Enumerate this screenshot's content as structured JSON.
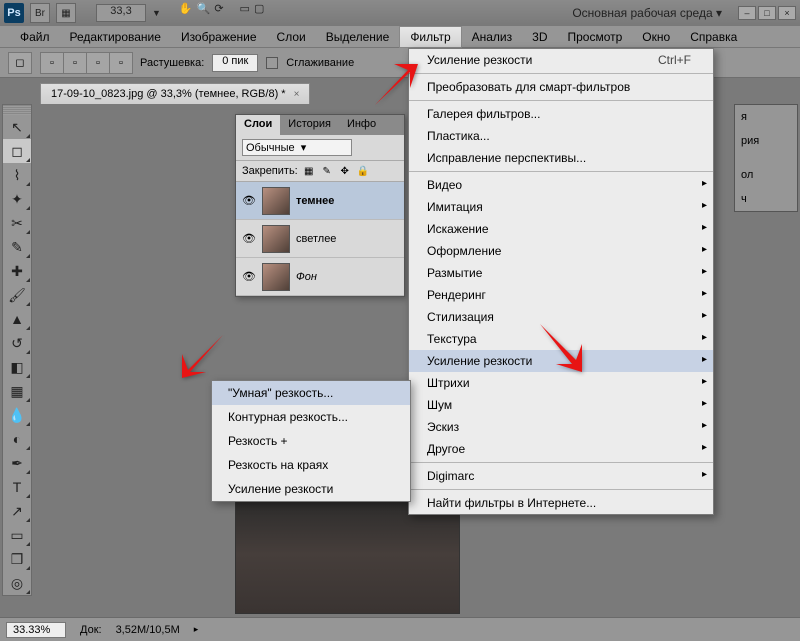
{
  "titlebar": {
    "zoom": "33,3",
    "workspace": "Основная рабочая среда ▾"
  },
  "menubar": {
    "items": [
      "Файл",
      "Редактирование",
      "Изображение",
      "Слои",
      "Выделение",
      "Фильтр",
      "Анализ",
      "3D",
      "Просмотр",
      "Окно",
      "Справка"
    ],
    "active_index": 5
  },
  "optionsbar": {
    "feather_label": "Растушевка:",
    "feather_value": "0 пик",
    "antialias_label": "Сглаживание"
  },
  "doctab": {
    "title": "17-09-10_0823.jpg @ 33,3% (темнее, RGB/8) *"
  },
  "layers_panel": {
    "tabs": [
      "Слои",
      "История",
      "Инфо"
    ],
    "active_tab": 0,
    "blend_mode": "Обычные",
    "lock_label": "Закрепить:",
    "layers": [
      {
        "name": "темнее",
        "selected": true,
        "bold": true
      },
      {
        "name": "светлее",
        "selected": false,
        "bold": false
      },
      {
        "name": "Фон",
        "selected": false,
        "bold": false,
        "italic": true
      }
    ]
  },
  "right_dock": {
    "items": [
      "я",
      "рия",
      "ол",
      "ч"
    ]
  },
  "filter_menu": {
    "top": {
      "label": "Усиление резкости",
      "shortcut": "Ctrl+F"
    },
    "smart": "Преобразовать для смарт-фильтров",
    "gallery": "Галерея фильтров...",
    "liquify": "Пластика...",
    "vanishing": "Исправление перспективы...",
    "groups": [
      "Видео",
      "Имитация",
      "Искажение",
      "Оформление",
      "Размытие",
      "Рендеринг",
      "Стилизация",
      "Текстура",
      "Усиление резкости",
      "Штрихи",
      "Шум",
      "Эскиз",
      "Другое"
    ],
    "highlight_index": 8,
    "digimarc": "Digimarc",
    "online": "Найти фильтры в Интернете..."
  },
  "sharpen_submenu": {
    "items": [
      "\"Умная\" резкость...",
      "Контурная резкость...",
      "Резкость +",
      "Резкость на краях",
      "Усиление резкости"
    ],
    "highlight_index": 0
  },
  "statusbar": {
    "zoom": "33.33%",
    "doc_label": "Док:",
    "doc_value": "3,52M/10,5M"
  }
}
